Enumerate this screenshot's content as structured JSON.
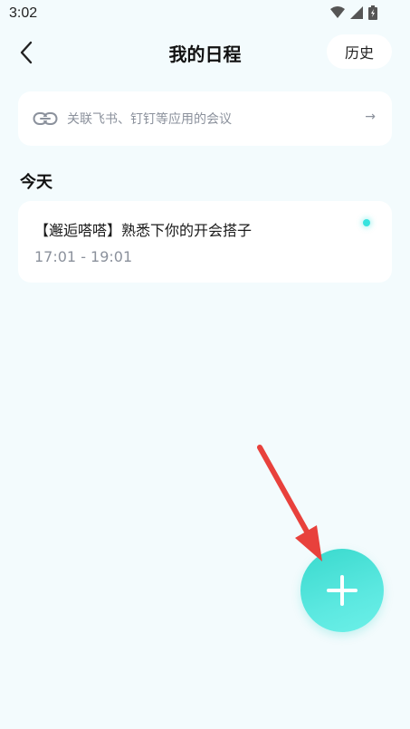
{
  "status_bar": {
    "time": "3:02",
    "icons": [
      "wifi-icon",
      "signal-icon",
      "battery-icon"
    ]
  },
  "header": {
    "back_icon": "chevron-left-icon",
    "title": "我的日程",
    "history_label": "历史"
  },
  "link_card": {
    "icon": "link-icon",
    "text": "关联飞书、钉钉等应用的会议",
    "arrow": "→"
  },
  "today": {
    "section_title": "今天",
    "events": [
      {
        "title": "【邂逅嗒嗒】熟悉下你的开会搭子",
        "time": "17:01 - 19:01",
        "status_color": "#36e3de"
      }
    ]
  },
  "fab": {
    "icon": "plus-icon",
    "color": "#4fe3da"
  },
  "annotation": {
    "icon": "red-arrow-icon",
    "color": "#e8413c"
  }
}
